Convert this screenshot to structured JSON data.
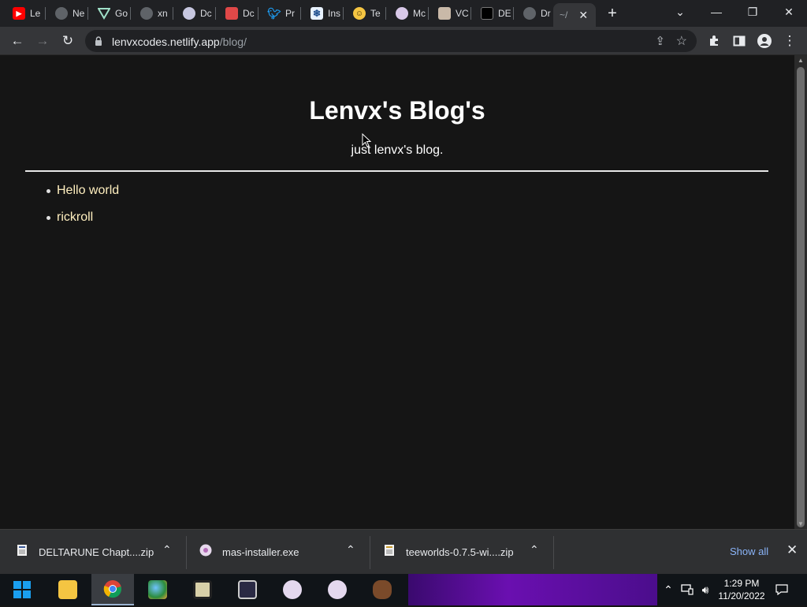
{
  "browser": {
    "tabs": [
      {
        "label": "Le",
        "icon": "youtube-icon",
        "color": "#ff0000"
      },
      {
        "label": "Ne",
        "icon": "chrome-icon",
        "color": "#9aa0a6"
      },
      {
        "label": "Go",
        "icon": "vuejs-icon",
        "color": "#41b883"
      },
      {
        "label": "xn",
        "icon": "globe-icon",
        "color": "#9aa0a6"
      },
      {
        "label": "Dc",
        "icon": "avatar-icon",
        "color": "#c7c7e0"
      },
      {
        "label": "Dc",
        "icon": "app-icon",
        "color": "#e04848"
      },
      {
        "label": "Pr",
        "icon": "twitter-icon",
        "color": "#1d9bf0"
      },
      {
        "label": "Ins",
        "icon": "snowflake-icon",
        "color": "#cfe6ff"
      },
      {
        "label": "Te",
        "icon": "emoji-icon",
        "color": "#f5c542"
      },
      {
        "label": "Mc",
        "icon": "avatar-icon",
        "color": "#d8c8e8"
      },
      {
        "label": "VC",
        "icon": "cube-icon",
        "color": "#c9b9a8"
      },
      {
        "label": "DE",
        "icon": "game-icon",
        "color": "#000000"
      },
      {
        "label": "Dr",
        "icon": "globe-icon",
        "color": "#9aa0a6"
      },
      {
        "label": "~/",
        "icon": "none",
        "color": "#353639"
      }
    ],
    "active_tab_index": 13,
    "url_host": "lenvxcodes.netlify.app",
    "url_path": "/blog/"
  },
  "page": {
    "title": "Lenvx's Blog's",
    "subtitle": "just lenvx's blog.",
    "posts": [
      "Hello world",
      "rickroll"
    ]
  },
  "downloads": {
    "items": [
      {
        "name": "DELTARUNE Chapt....zip",
        "icon": "zip-icon"
      },
      {
        "name": "mas-installer.exe",
        "icon": "installer-icon"
      },
      {
        "name": "teeworlds-0.7.5-wi....zip",
        "icon": "zip-icon"
      }
    ],
    "show_all": "Show all"
  },
  "taskbar": {
    "apps": [
      "file-explorer-icon",
      "chrome-icon",
      "paint-icon",
      "app-icon",
      "app-icon",
      "avatar-icon",
      "avatar-icon",
      "coffee-icon"
    ],
    "time": "1:29 PM",
    "date": "11/20/2022"
  },
  "colors": {
    "page_bg": "#151515",
    "link": "#ffefbf",
    "chrome_dark": "#202124",
    "chrome_toolbar": "#353639",
    "show_all": "#8ab4f8"
  }
}
